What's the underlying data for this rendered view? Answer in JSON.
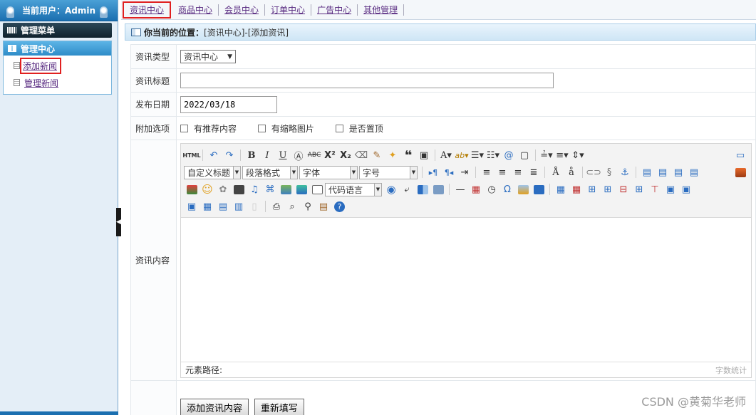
{
  "left": {
    "user_label": "当前用户：Admin",
    "menu_title": "管理菜单",
    "group_title": "管理中心",
    "items": [
      {
        "label": "添加新闻"
      },
      {
        "label": "管理新闻"
      }
    ]
  },
  "topnav": {
    "items": [
      {
        "label": "资讯中心"
      },
      {
        "label": "商品中心"
      },
      {
        "label": "会员中心"
      },
      {
        "label": "订单中心"
      },
      {
        "label": "广告中心"
      },
      {
        "label": "其他管理"
      }
    ]
  },
  "breadcrumb": {
    "label": "你当前的位置：",
    "path": "[资讯中心]-[添加资讯]"
  },
  "form": {
    "category_label": "资讯类型",
    "category_value": "资讯中心",
    "title_label": "资讯标题",
    "title_value": "",
    "date_label": "发布日期",
    "date_value": "2022/03/18",
    "options_label": "附加选项",
    "options": [
      {
        "label": "有推荐内容"
      },
      {
        "label": "有缩略图片"
      },
      {
        "label": "是否置顶"
      }
    ],
    "content_label": "资讯内容"
  },
  "editor": {
    "html_button": "HTML",
    "custom_title": "自定义标题",
    "paragraph": "段落格式",
    "font": "字体",
    "font_size": "字号",
    "code_lang": "代码语言",
    "path_label": "元素路径:",
    "word_count": "字数统计"
  },
  "buttons": {
    "submit": "添加资讯内容",
    "reset": "重新填写"
  },
  "watermark": "CSDN @黄菊华老师",
  "colors": {
    "link": "#5a2d82",
    "highlight": "#e02020",
    "header_blue": "#1b6fb0"
  }
}
